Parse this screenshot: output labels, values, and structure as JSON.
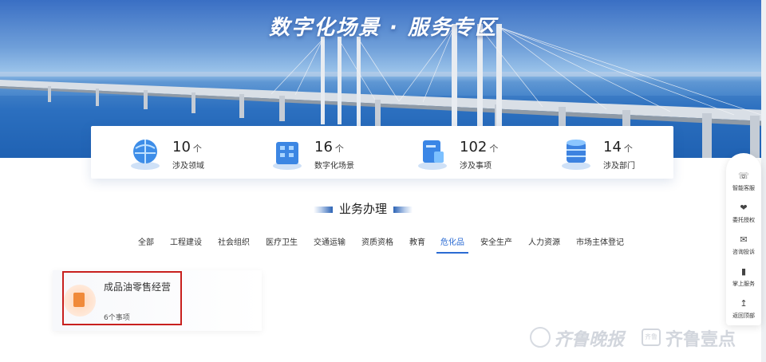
{
  "banner": {
    "title": "数字化场景 · 服务专区"
  },
  "stats": [
    {
      "value": "10",
      "unit": "个",
      "label": "涉及领域",
      "icon": "globe-icon"
    },
    {
      "value": "16",
      "unit": "个",
      "label": "数字化场景",
      "icon": "building-icon"
    },
    {
      "value": "102",
      "unit": "个",
      "label": "涉及事项",
      "icon": "document-stamp-icon"
    },
    {
      "value": "14",
      "unit": "个",
      "label": "涉及部门",
      "icon": "database-icon"
    }
  ],
  "section": {
    "title": "业务办理"
  },
  "tabs": [
    {
      "label": "全部"
    },
    {
      "label": "工程建设"
    },
    {
      "label": "社会组织"
    },
    {
      "label": "医疗卫生"
    },
    {
      "label": "交通运输"
    },
    {
      "label": "资质资格"
    },
    {
      "label": "教育"
    },
    {
      "label": "危化品",
      "active": true
    },
    {
      "label": "安全生产"
    },
    {
      "label": "人力资源"
    },
    {
      "label": "市场主体登记"
    }
  ],
  "service_card": {
    "title": "成品油零售经营",
    "count": "6个事项",
    "icon": "oil-canister-icon"
  },
  "sidebar": [
    {
      "label": "智能客服",
      "icon": "headset-icon"
    },
    {
      "label": "委托授权",
      "icon": "handshake-icon"
    },
    {
      "label": "咨询投诉",
      "icon": "mail-icon"
    },
    {
      "label": "掌上服务",
      "icon": "phone-icon"
    },
    {
      "label": "返回顶部",
      "icon": "arrow-up-icon"
    }
  ],
  "watermark": {
    "text_a": "齐鲁晚报",
    "box": "齐鲁",
    "text_b": "齐鲁壹点"
  },
  "colors": {
    "accent": "#2b6bd3",
    "highlight": "#c8201e",
    "banner_sea": "#2f74c4"
  }
}
